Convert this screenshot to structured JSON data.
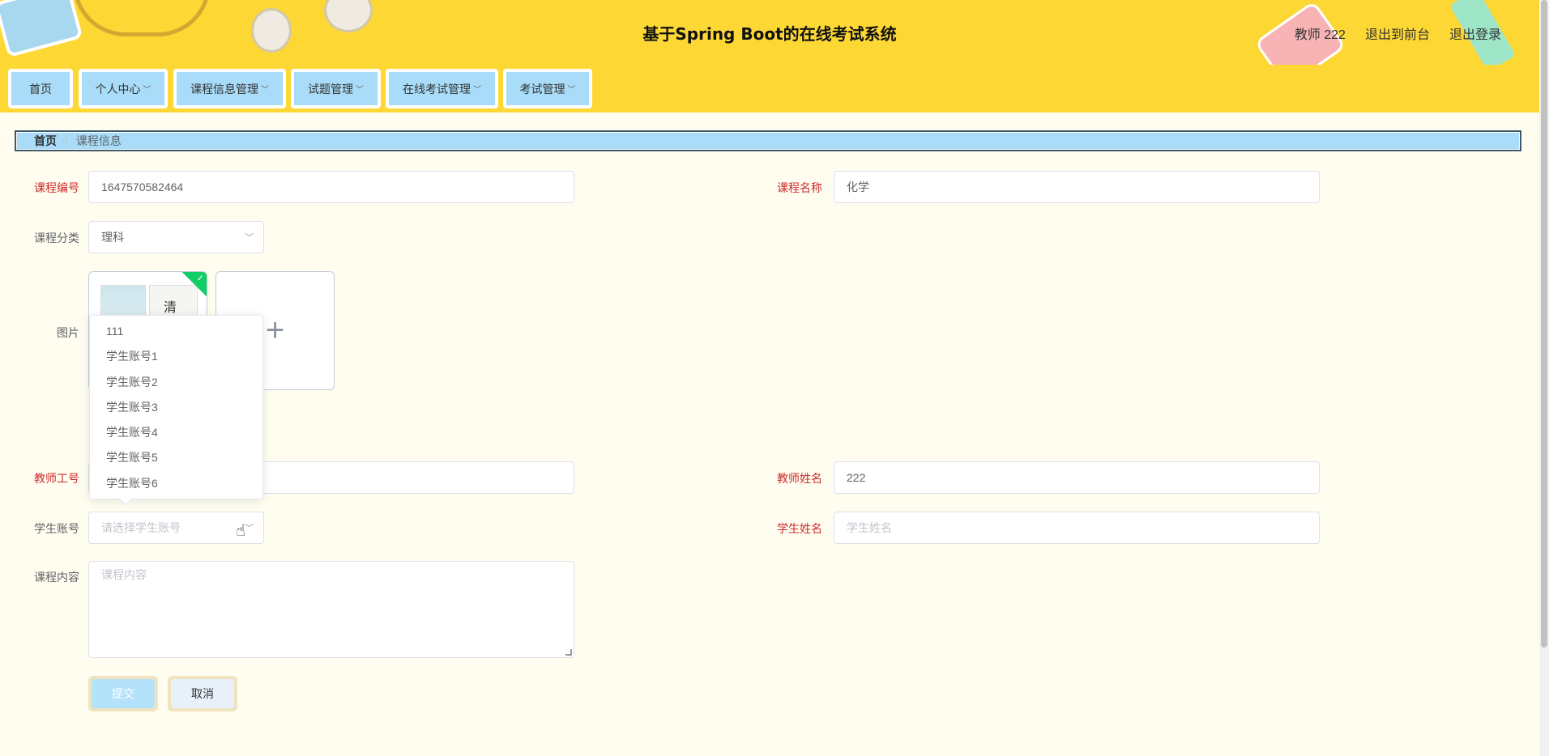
{
  "header": {
    "title": "基于Spring Boot的在线考试系统",
    "user": "教师 222",
    "back_to_front": "退出到前台",
    "logout": "退出登录"
  },
  "nav": {
    "items": [
      {
        "label": "首页"
      },
      {
        "label": "个人中心"
      },
      {
        "label": "课程信息管理"
      },
      {
        "label": "试题管理"
      },
      {
        "label": "在线考试管理"
      },
      {
        "label": "考试管理"
      }
    ]
  },
  "breadcrumb": {
    "home": "首页",
    "separator": "/",
    "current": "课程信息"
  },
  "form": {
    "course_no": {
      "label": "课程编号",
      "value": "1647570582464"
    },
    "course_name": {
      "label": "课程名称",
      "value": "化学"
    },
    "course_category": {
      "label": "课程分类",
      "value": "理科"
    },
    "image": {
      "label": "图片"
    },
    "teacher_no": {
      "label": "教师工号",
      "value": ""
    },
    "teacher_name": {
      "label": "教师姓名",
      "value": "222"
    },
    "student_account": {
      "label": "学生账号",
      "placeholder": "请选择学生账号"
    },
    "student_name": {
      "label": "学生姓名",
      "placeholder": "学生姓名"
    },
    "course_content": {
      "label": "课程内容",
      "placeholder": "课程内容"
    },
    "submit": "提交",
    "cancel": "取消"
  },
  "dropdown": {
    "options": [
      "111",
      "学生账号1",
      "学生账号2",
      "学生账号3",
      "学生账号4",
      "学生账号5",
      "学生账号6"
    ]
  },
  "icons": {
    "chevron": "chevron-down-icon",
    "plus": "plus-icon",
    "check": "check-icon",
    "cursor": "hand-cursor-icon"
  }
}
